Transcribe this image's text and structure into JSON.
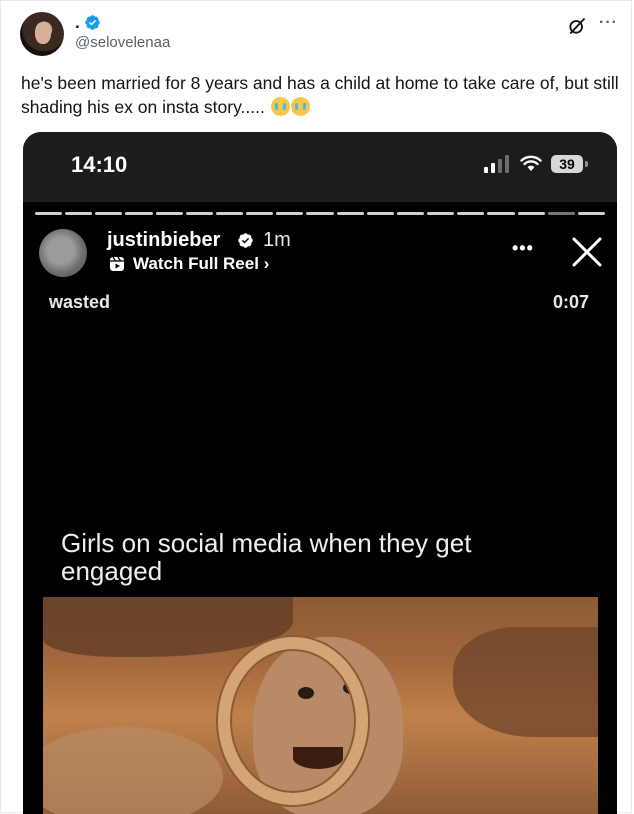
{
  "tweet": {
    "display_name": ".",
    "handle": "@selovelenaa",
    "text": "he's been married for 8 years and has a child at home to take care of, but still shading his ex on insta story.....",
    "emoji_count": 2,
    "more_label": "···"
  },
  "phone_status": {
    "time": "14:10",
    "battery": "39"
  },
  "story": {
    "segments_total": 19,
    "current_segment": 18,
    "username": "justinbieber",
    "age": "1m",
    "reel_link": "Watch Full Reel ›",
    "more_label": "•••",
    "audio_label": "wasted",
    "duration": "0:07",
    "caption": "Girls on social media when they get engaged"
  },
  "colors": {
    "verified_blue": "#1d9bf0",
    "card_bg": "#000000",
    "statusbar_bg": "#1c1c1e"
  },
  "icons": [
    "verified-icon",
    "grok-icon",
    "more-icon",
    "signal-icon",
    "wifi-icon",
    "battery-icon",
    "reel-icon",
    "close-icon"
  ]
}
